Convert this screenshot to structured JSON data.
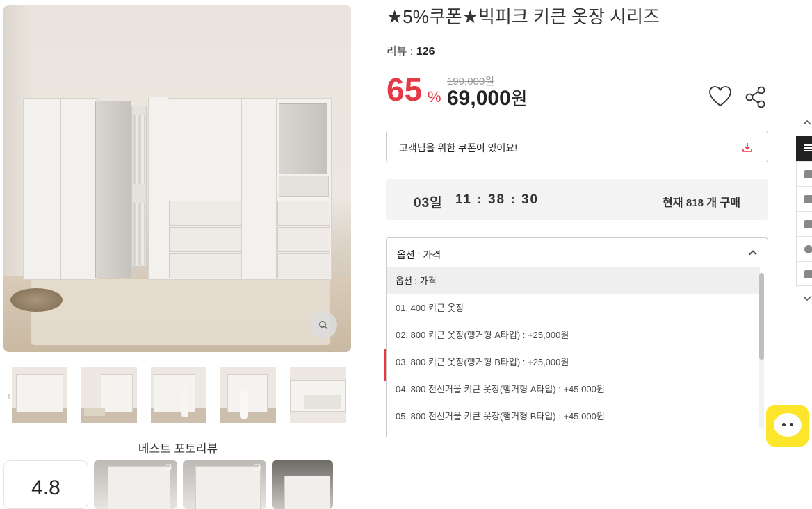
{
  "product": {
    "title": "★5%쿠폰★빅피크 키큰 옷장 시리즈",
    "reviews_label": "리뷰 :",
    "reviews_count": "126",
    "discount": "65",
    "discount_unit": "%",
    "original_price": "199,000원",
    "price": "69,000",
    "price_unit": "원"
  },
  "coupon": {
    "label": "고객님을 위한 쿠폰이 있어요!"
  },
  "timer": {
    "day": "03일",
    "time": "11 : 38 : 30",
    "buy_prefix": "현재",
    "buy_count": "818",
    "buy_suffix": "개 구매"
  },
  "options": {
    "head": "옵션 : 가격",
    "items": [
      "옵션 : 가격",
      "01. 400 키큰 옷장",
      "02. 800 키큰 옷장(행거형 A타입) : +25,000원",
      "03. 800 키큰 옷장(행거형 B타입) : +25,000원",
      "04. 800 전신거울 키큰 옷장(행거형 A타입) : +45,000원",
      "05. 800 전신거울 키큰 옷장(행거형 B타입) : +45,000원"
    ],
    "selected_index": 0
  },
  "gallery": {
    "best_title": "베스트 포토리뷰",
    "rating": "4.8",
    "thumb_count": 5
  },
  "icons": [
    "search-icon",
    "heart-icon",
    "share-icon",
    "download-icon",
    "chevron-up-icon",
    "menu-icon",
    "home-icon",
    "truck-icon",
    "cart-icon",
    "user-icon",
    "heart-icon",
    "chevron-down-icon",
    "chat-icon"
  ],
  "colors": {
    "accent": "#e63946",
    "chat": "#fde52c"
  }
}
